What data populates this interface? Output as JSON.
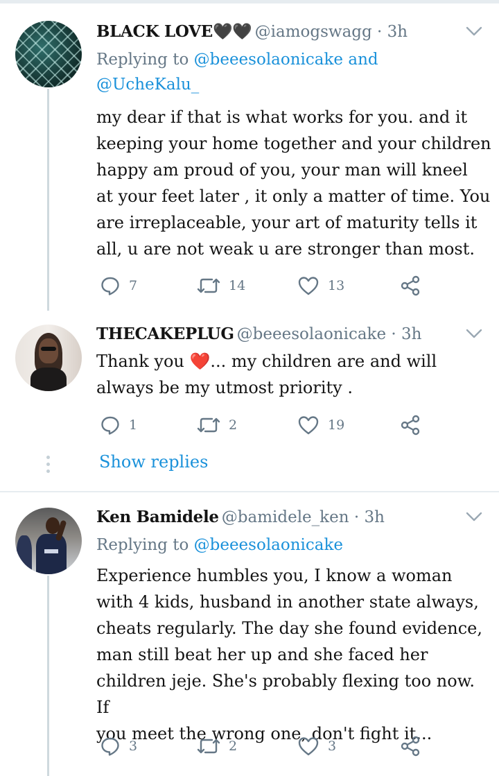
{
  "tweets": [
    {
      "name": "BLACK LOVE🖤🖤",
      "handle": "@iamogswagg",
      "time": "· 3h",
      "replying_prefix": "Replying to ",
      "replying_mention1": "@beeesolaonicake",
      "replying_and": " and",
      "replying_mention2": "@UcheKalu_",
      "lines": [
        "my dear if that is what works for you. and it",
        "keeping your home together and your children",
        "happy am proud of you, your man will kneel",
        "at your feet later , it only a matter of time. You",
        "are irreplaceable, your  art of maturity tells it",
        "all, u are not weak u are stronger than most."
      ],
      "replies": "7",
      "retweets": "14",
      "likes": "13"
    },
    {
      "name": "THECAKEPLUG",
      "handle": "@beeesolaonicake",
      "time": "· 3h",
      "lines": [
        "Thank you ❤️... my children are and will",
        "always be my utmost priority ."
      ],
      "replies": "1",
      "retweets": "2",
      "likes": "19"
    },
    {
      "name": "Ken Bamidele",
      "handle": "@bamidele_ken",
      "time": "· 3h",
      "replying_prefix": "Replying to ",
      "replying_mention1": "@beeesolaonicake",
      "lines": [
        "Experience humbles you, I know a woman",
        "with 4 kids, husband in another state always,",
        "cheats regularly. The day she found evidence,",
        "man still beat her up and she faced her",
        "children jeje. She's probably flexing too now. If",
        "you meet the wrong one, don't fight it..."
      ],
      "replies": "3",
      "retweets": "2",
      "likes": "3"
    }
  ],
  "show_replies": "Show replies",
  "icons": [
    "reply-icon",
    "retweet-icon",
    "like-icon",
    "share-icon",
    "chevron-down-icon"
  ],
  "colors": {
    "link": "#1a91da",
    "muted": "#657786",
    "divider": "#e6ecf0",
    "heart": "#e0245e"
  }
}
